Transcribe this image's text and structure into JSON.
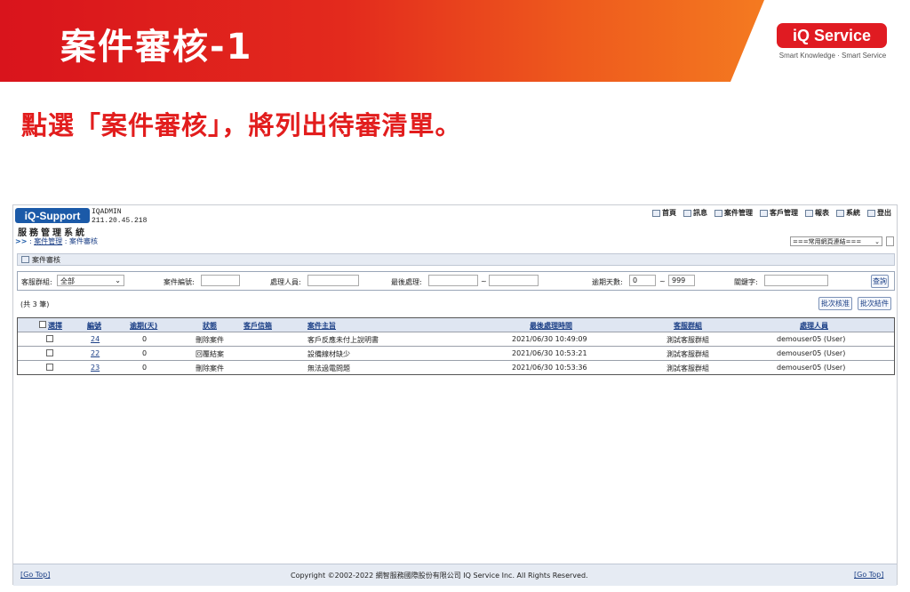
{
  "slide": {
    "title": "案件審核-1",
    "subtitle": "點選「案件審核」，將列出待審清單。",
    "logo": "iQ Service",
    "logo_tagline": "Smart Knowledge · Smart Service"
  },
  "app": {
    "badge": "iQ-Support",
    "system_name": "服務管理系統",
    "user": "IQADMIN",
    "ip": "211.20.45.218",
    "nav": [
      "首頁",
      "訊息",
      "案件管理",
      "客戶管理",
      "報表",
      "系統",
      "登出"
    ],
    "breadcrumb_prefix": ">>",
    "breadcrumb_module": "案件管理",
    "breadcrumb_page": "案件審核",
    "quick_link": "===常用網頁連結==="
  },
  "section_title": "案件審核",
  "filters": {
    "group_label": "客服群組:",
    "group_value": "全部",
    "case_no_label": "案件編號:",
    "handler_label": "處理人員:",
    "last_label": "最後處理:",
    "tilde": "~",
    "overdue_label": "逾期天數:",
    "overdue_from": "0",
    "overdue_to": "999",
    "keyword_label": "關鍵字:",
    "search_btn": "查詢"
  },
  "count": "(共 3 筆)",
  "actions": {
    "batch_approve": "批次核准",
    "batch_close": "批次結件"
  },
  "table": {
    "headers": [
      "選擇",
      "編號",
      "逾期(天)",
      "狀態",
      "客戶信箱",
      "案件主旨",
      "最後處理時間",
      "客服群組",
      "處理人員"
    ],
    "rows": [
      {
        "id": "24",
        "overdue": "0",
        "status": "刪除案件",
        "email": "",
        "subject": "客戶反應未付上說明書",
        "time": "2021/06/30 10:49:09",
        "group": "測試客服群組",
        "handler": "demouser05 (User)"
      },
      {
        "id": "22",
        "overdue": "0",
        "status": "回覆結案",
        "email": "",
        "subject": "設備線材缺少",
        "time": "2021/06/30 10:53:21",
        "group": "測試客服群組",
        "handler": "demouser05 (User)"
      },
      {
        "id": "23",
        "overdue": "0",
        "status": "刪除案件",
        "email": "",
        "subject": "無法過電問題",
        "time": "2021/06/30 10:53:36",
        "group": "測試客服群組",
        "handler": "demouser05 (User)"
      }
    ]
  },
  "footer": {
    "go_top": "[Go Top]",
    "copyright": "Copyright ©2002-2022 網智服務國際股份有限公司 IQ Service Inc. All Rights Reserved."
  }
}
